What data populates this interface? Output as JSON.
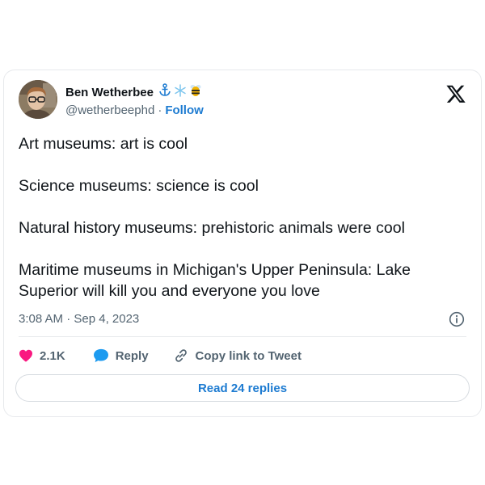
{
  "author": {
    "name": "Ben Wetherbee",
    "handle": "@wetherbeephd",
    "separator": "·",
    "follow_label": "Follow",
    "emoji_icons": [
      "anchor-icon",
      "snowflake-icon",
      "bee-icon"
    ]
  },
  "tweet": {
    "lines": [
      "Art museums: art is cool",
      "Science museums: science is cool",
      "Natural history museums: prehistoric animals were cool",
      "Maritime museums in Michigan's Upper Peninsula: Lake Superior will kill you and everyone you love"
    ],
    "timestamp": "3:08 AM · Sep 4, 2023"
  },
  "actions": {
    "likes": "2.1K",
    "reply_label": "Reply",
    "copy_label": "Copy link to Tweet"
  },
  "read_replies": "Read 24 replies",
  "colors": {
    "like": "#f91880",
    "link": "#1d7bd1",
    "reply_bubble": "#1d9bf0",
    "muted": "#536471"
  }
}
